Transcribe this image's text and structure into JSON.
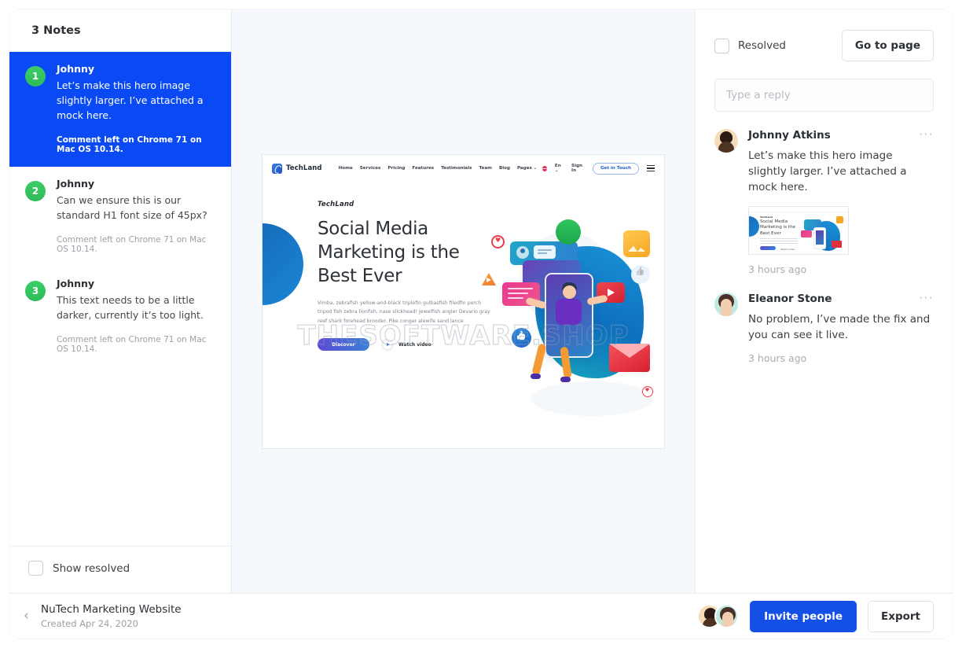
{
  "sidebar": {
    "title": "3 Notes",
    "notes": [
      {
        "number": "1",
        "author": "Johnny",
        "text": "Let’s make this hero image slightly larger. I’ve attached a mock here.",
        "meta": "Comment left on Chrome 71 on Mac OS 10.14."
      },
      {
        "number": "2",
        "author": "Johnny",
        "text": "Can we ensure this is our standard H1 font size of 45px?",
        "meta": "Comment left on Chrome 71 on Mac OS 10.14."
      },
      {
        "number": "3",
        "author": "Johnny",
        "text": "This text needs to be a little darker, currently it’s too light.",
        "meta": "Comment left on Chrome 71 on Mac OS 10.14."
      }
    ],
    "show_resolved_label": "Show resolved"
  },
  "canvas": {
    "watermark": "THESOFTWARE.SHOP",
    "mock": {
      "brand": "TechLand",
      "nav_links": [
        "Home",
        "Services",
        "Pricing",
        "Features",
        "Testimonials",
        "Team",
        "Blog",
        "Pages ⌄"
      ],
      "language": "En ⌄",
      "sign_in": "Sign In",
      "cta": "Get in Touch",
      "hero_brand": "TechLand",
      "hero_heading": "Social Media Marketing is the Best Ever",
      "hero_paragraph": "Vimba, zebrafish yellow-and-black triplefin gulbasfish filedfin perch tripod fish zebra lionfish, nase slickhead! Jewelfish angler Devario gray reef shark forehead brooder. Pike conger alewife sand lance",
      "btn_discover": "Discover",
      "btn_watch": "Watch video"
    }
  },
  "right_panel": {
    "resolved_label": "Resolved",
    "go_to_page_label": "Go to page",
    "reply_placeholder": "Type a reply",
    "comments": [
      {
        "name": "Johnny Atkins",
        "text": "Let’s make this hero image slightly larger. I’ve attached a mock here.",
        "time": "3 hours ago",
        "kebab": "···",
        "has_attachment": true,
        "attachment_heading": "Social Media Marketing is the Best Ever",
        "attachment_brand": "TechLand",
        "attachment_watch": "Watch video"
      },
      {
        "name": "Eleanor Stone",
        "text": "No problem, I’ve made the fix and you can see it live.",
        "time": "3 hours ago",
        "kebab": "···",
        "has_attachment": false
      }
    ]
  },
  "footer": {
    "back_icon": "‹",
    "project_name": "NuTech Marketing Website",
    "project_created": "Created Apr 24, 2020",
    "invite_label": "Invite people",
    "export_label": "Export"
  },
  "colors": {
    "active_note_blue": "#0A4AF5",
    "primary_blue": "#1450E6",
    "badge_green": "#2dbb58",
    "canvas_bg": "#F5F8FC"
  }
}
